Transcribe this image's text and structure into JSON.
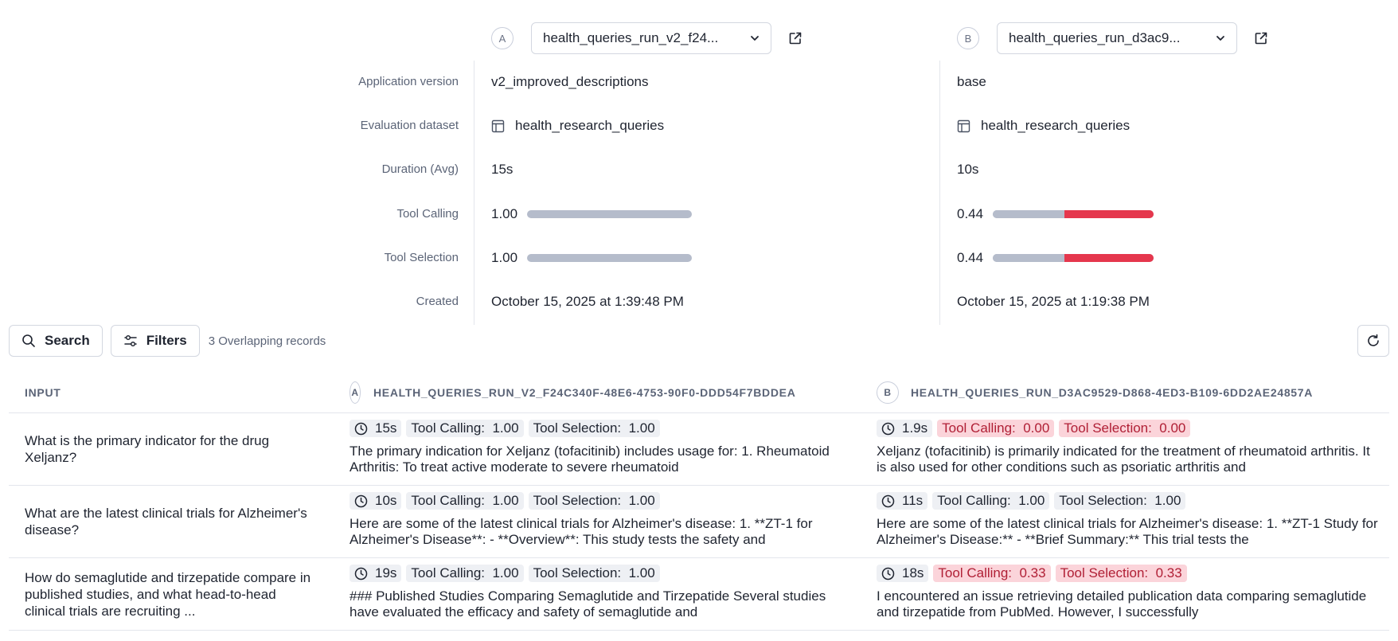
{
  "runs": {
    "a": {
      "badge": "A",
      "name": "health_queries_run_v2_f24...",
      "app_version": "v2_improved_descriptions",
      "dataset": "health_research_queries",
      "duration": "15s",
      "tool_calling": "1.00",
      "tool_calling_value": 1.0,
      "tool_selection": "1.00",
      "tool_selection_value": 1.0,
      "created": "October 15, 2025 at 1:39:48 PM"
    },
    "b": {
      "badge": "B",
      "name": "health_queries_run_d3ac9...",
      "app_version": "base",
      "dataset": "health_research_queries",
      "duration": "10s",
      "tool_calling": "0.44",
      "tool_calling_value": 0.44,
      "tool_selection": "0.44",
      "tool_selection_value": 0.44,
      "created": "October 15, 2025 at 1:19:38 PM"
    }
  },
  "labels": {
    "app_version": "Application version",
    "dataset": "Evaluation dataset",
    "duration": "Duration (Avg)",
    "tool_calling": "Tool Calling",
    "tool_selection": "Tool Selection",
    "created": "Created"
  },
  "toolbar": {
    "search_label": "Search",
    "filters_label": "Filters",
    "overlap_text": "3 Overlapping records"
  },
  "table": {
    "col_input": "Input",
    "col_a_badge": "A",
    "col_a": "health_queries_run_v2_f24c340f-48e6-4753-90f0-ddd54f7bddea",
    "col_b_badge": "B",
    "col_b": "health_queries_run_d3ac9529-d868-4ed3-b109-6dd2ae24857a",
    "rows": [
      {
        "input": "What is the primary indicator for the drug Xeljanz?",
        "a": {
          "duration": "15s",
          "tool_calling": "Tool Calling:  1.00",
          "tool_selection": "Tool Selection:  1.00",
          "response": "The primary indication for Xeljanz (tofacitinib) includes usage for: 1. Rheumatoid Arthritis: To treat active moderate to severe rheumatoid"
        },
        "b": {
          "duration": "1.9s",
          "tool_calling": "Tool Calling:  0.00",
          "tool_selection": "Tool Selection:  0.00",
          "response": "Xeljanz (tofacitinib) is primarily indicated for the treatment of rheumatoid arthritis. It is also used for other conditions such as psoriatic arthritis and"
        }
      },
      {
        "input": "What are the latest clinical trials for Alzheimer's disease?",
        "a": {
          "duration": "10s",
          "tool_calling": "Tool Calling:  1.00",
          "tool_selection": "Tool Selection:  1.00",
          "response": "Here are some of the latest clinical trials for Alzheimer's disease: 1. **ZT-1 for Alzheimer's Disease**: - **Overview**: This study tests the safety and"
        },
        "b": {
          "duration": "11s",
          "tool_calling": "Tool Calling:  1.00",
          "tool_selection": "Tool Selection:  1.00",
          "response": "Here are some of the latest clinical trials for Alzheimer's disease: 1. **ZT-1 Study for Alzheimer's Disease:** - **Brief Summary:** This trial tests the"
        }
      },
      {
        "input": "How do semaglutide and tirzepatide compare in published studies, and what head-to-head clinical trials are recruiting ...",
        "a": {
          "duration": "19s",
          "tool_calling": "Tool Calling:  1.00",
          "tool_selection": "Tool Selection:  1.00",
          "response": "### Published Studies Comparing Semaglutide and Tirzepatide Several studies have evaluated the efficacy and safety of semaglutide and"
        },
        "b": {
          "duration": "18s",
          "tool_calling": "Tool Calling:  0.33",
          "tool_selection": "Tool Selection:  0.33",
          "response": "I encountered an issue retrieving detailed publication data comparing semaglutide and tirzepatide from PubMed. However, I successfully"
        }
      }
    ]
  },
  "colors": {
    "bar_ok": "#b5bccb",
    "bar_bad": "#e5374d",
    "chip_bad_bg": "#fbd4da"
  },
  "icons": {
    "dropdown": "chevron-down-icon",
    "open_external": "external-link-icon",
    "dataset": "table-icon",
    "search": "search-icon",
    "filters": "sliders-icon",
    "refresh": "refresh-icon",
    "duration": "clock-icon"
  }
}
